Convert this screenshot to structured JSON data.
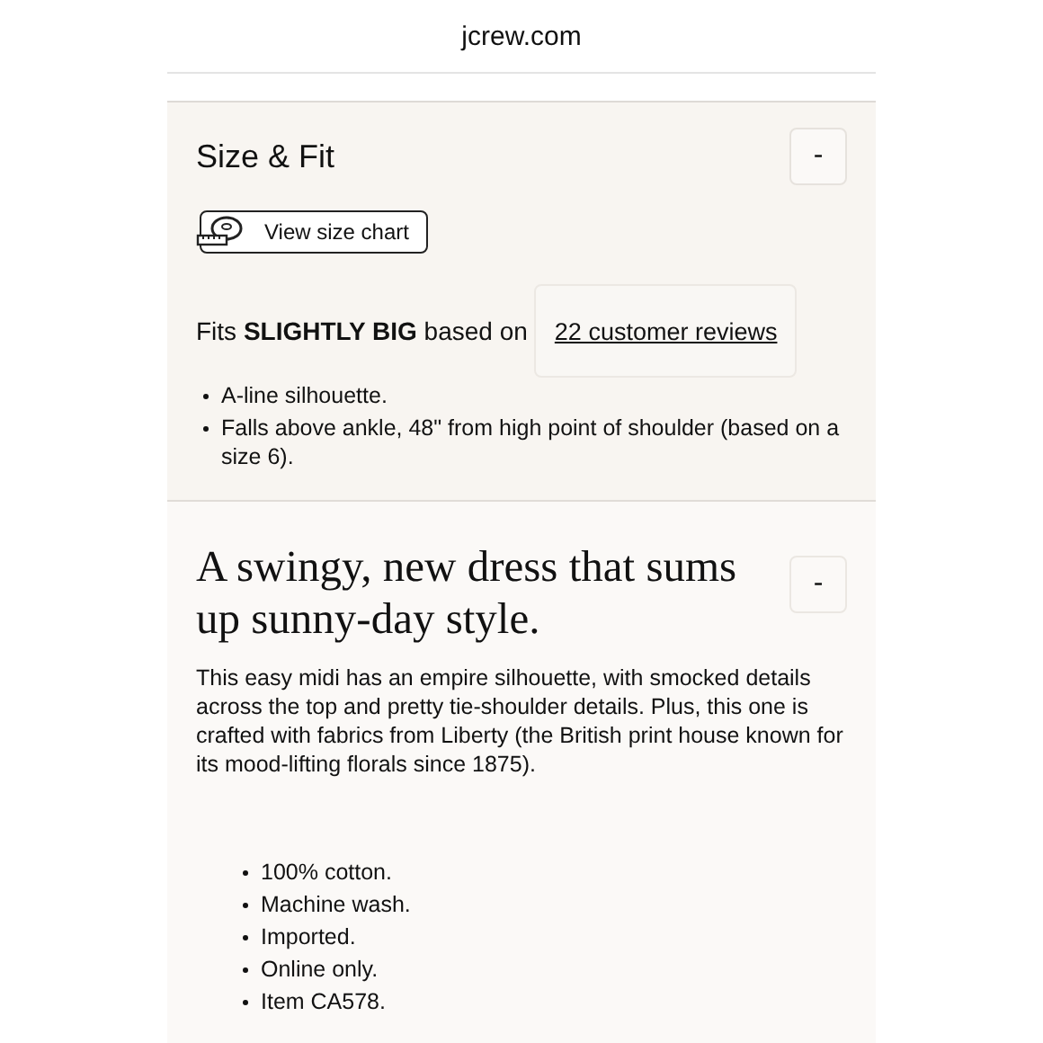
{
  "address_bar": {
    "url": "jcrew.com"
  },
  "size_fit": {
    "title": "Size & Fit",
    "toggle": "-",
    "size_chart_button": "View size chart",
    "fit_text": "Fits **SLIGHTLY BIG** based on",
    "reviews_link": "22 customer reviews",
    "bullets": [
      "A-line silhouette.",
      "Falls above ankle, 48\" from high point of shoulder (based on a size 6)."
    ]
  },
  "description": {
    "title": "A swingy, new dress that sums up sunny-day style.",
    "toggle": "-",
    "body": "This easy midi has an empire silhouette, with smocked details across the top and pretty tie-shoulder details. Plus, this one is crafted with fabrics from Liberty (the British print house known for its mood-lifting florals since 1875).",
    "bullets": [
      "100% cotton.",
      "Machine wash.",
      "Imported.",
      "Online only.",
      "Item CA578."
    ]
  }
}
